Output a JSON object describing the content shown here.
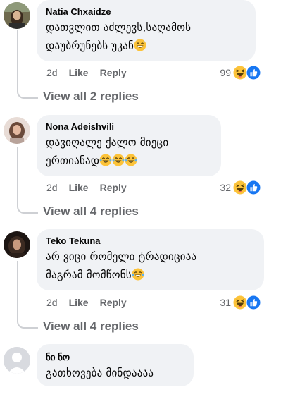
{
  "comments": [
    {
      "author": "Natia Chxaidze",
      "line1": "დათვლით აძლევს,საღამოს",
      "line2": "დაუბრუნებს უკან",
      "emoji": "grinning-sweat-emoji",
      "time": "2d",
      "like_label": "Like",
      "reply_label": "Reply",
      "reaction_count": "99",
      "view_replies": "View all 2 replies"
    },
    {
      "author": "Nona Adeishvili",
      "line1": "დავიღალე ქალო მიეცი",
      "line2": "ერთიანად",
      "emoji": "tears-of-joy-emoji",
      "time": "2d",
      "like_label": "Like",
      "reply_label": "Reply",
      "reaction_count": "32",
      "view_replies": "View all 4 replies"
    },
    {
      "author": "Teko Tekuna",
      "line1": "არ ვიცი რომელი ტრადიციაა",
      "line2": "მაგრამ მომწონს",
      "emoji": "tears-of-joy-emoji",
      "time": "2d",
      "like_label": "Like",
      "reply_label": "Reply",
      "reaction_count": "31",
      "view_replies": "View all 4 replies"
    },
    {
      "author": "ნი ნო",
      "line1": "გათხოვება მინდაააა"
    }
  ],
  "colors": {
    "bubble": "#f0f2f5",
    "meta_text": "#65676b",
    "like_blue": "#1877f2",
    "haha_yellow": "#fcc33a"
  },
  "icons": {
    "haha": "haha-reaction-icon",
    "like": "like-reaction-icon",
    "default_avatar": "default-avatar-icon"
  }
}
